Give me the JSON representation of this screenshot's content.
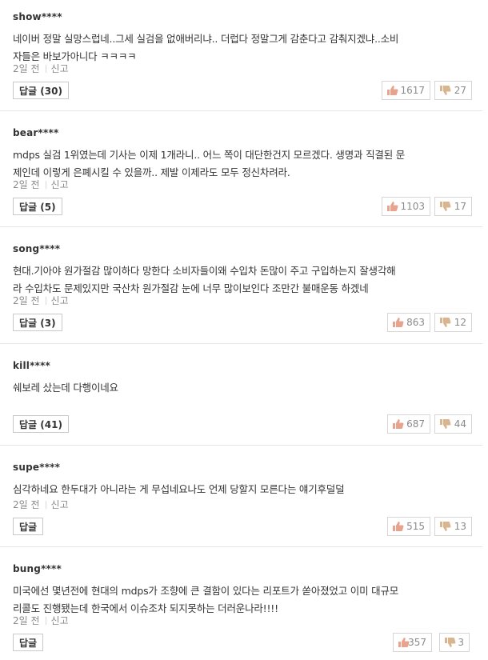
{
  "comments": [
    {
      "author": "show****",
      "lines": [
        "네이버 정말 실망스럽네..그세 실검을 없애버리냐.. 더럽다 정말그게 감춘다고 감춰지겠냐..소비",
        "자들은 바보가아니다 ㅋㅋㅋㅋ"
      ],
      "time": "2일 전",
      "report": "신고",
      "reply_label": "답글 (30)",
      "likes": "1617",
      "dislikes": "27"
    },
    {
      "author": "bear****",
      "lines": [
        "mdps 실검 1위였는데 기사는 이제 1개라니.. 어느 쪽이 대단한건지 모르겠다. 생명과 직결된 문",
        "제인데 이렇게 은폐시킬 수 있을까.. 제발 이제라도 모두 정신차려라."
      ],
      "time": "2일 전",
      "report": "신고",
      "reply_label": "답글 (5)",
      "likes": "1103",
      "dislikes": "17"
    },
    {
      "author": "song****",
      "lines": [
        "현대.기아야 원가절감 많이하다 망한다 소비자들이왜 수입차 돈많이 주고 구입하는지 잘생각해",
        "라 수입차도 문제있지만 국산차 원가절감 눈에 너무 많이보인다 조만간 불매운동 하겠네"
      ],
      "time": "2일 전",
      "report": "신고",
      "reply_label": "답글 (3)",
      "likes": "863",
      "dislikes": "12"
    },
    {
      "author": "kill****",
      "lines": [
        "쉐보레 샀는데 다행이네요"
      ],
      "time": "2일 전",
      "report": "신고",
      "reply_label": "답글 (41)",
      "likes": "687",
      "dislikes": "44"
    },
    {
      "author": "supe****",
      "lines": [
        "심각하네요 한두대가 아니라는 게 무섭네요나도 언제 당할지 모른다는 얘기후덜덜"
      ],
      "time": "2일 전",
      "report": "신고",
      "reply_label": "답글",
      "likes": "515",
      "dislikes": "13"
    },
    {
      "author": "bung****",
      "lines": [
        "미국에선 몇년전에 현대의 mdps가 조향에 큰 결함이 있다는 리포트가 쏟아졌었고 이미 대규모",
        "리콜도 진행됐는데 한국에서 이슈조차 되지못하는 더러운나라!!!!"
      ],
      "time": "2일 전",
      "report": "신고",
      "reply_label": "답글",
      "likes": "357",
      "dislikes": "3"
    }
  ],
  "icons": {
    "like": "thumbs-up-icon",
    "dislike": "thumbs-down-icon"
  },
  "colors": {
    "like_icon": "#e8a38f",
    "dislike_icon": "#d9b58f"
  }
}
